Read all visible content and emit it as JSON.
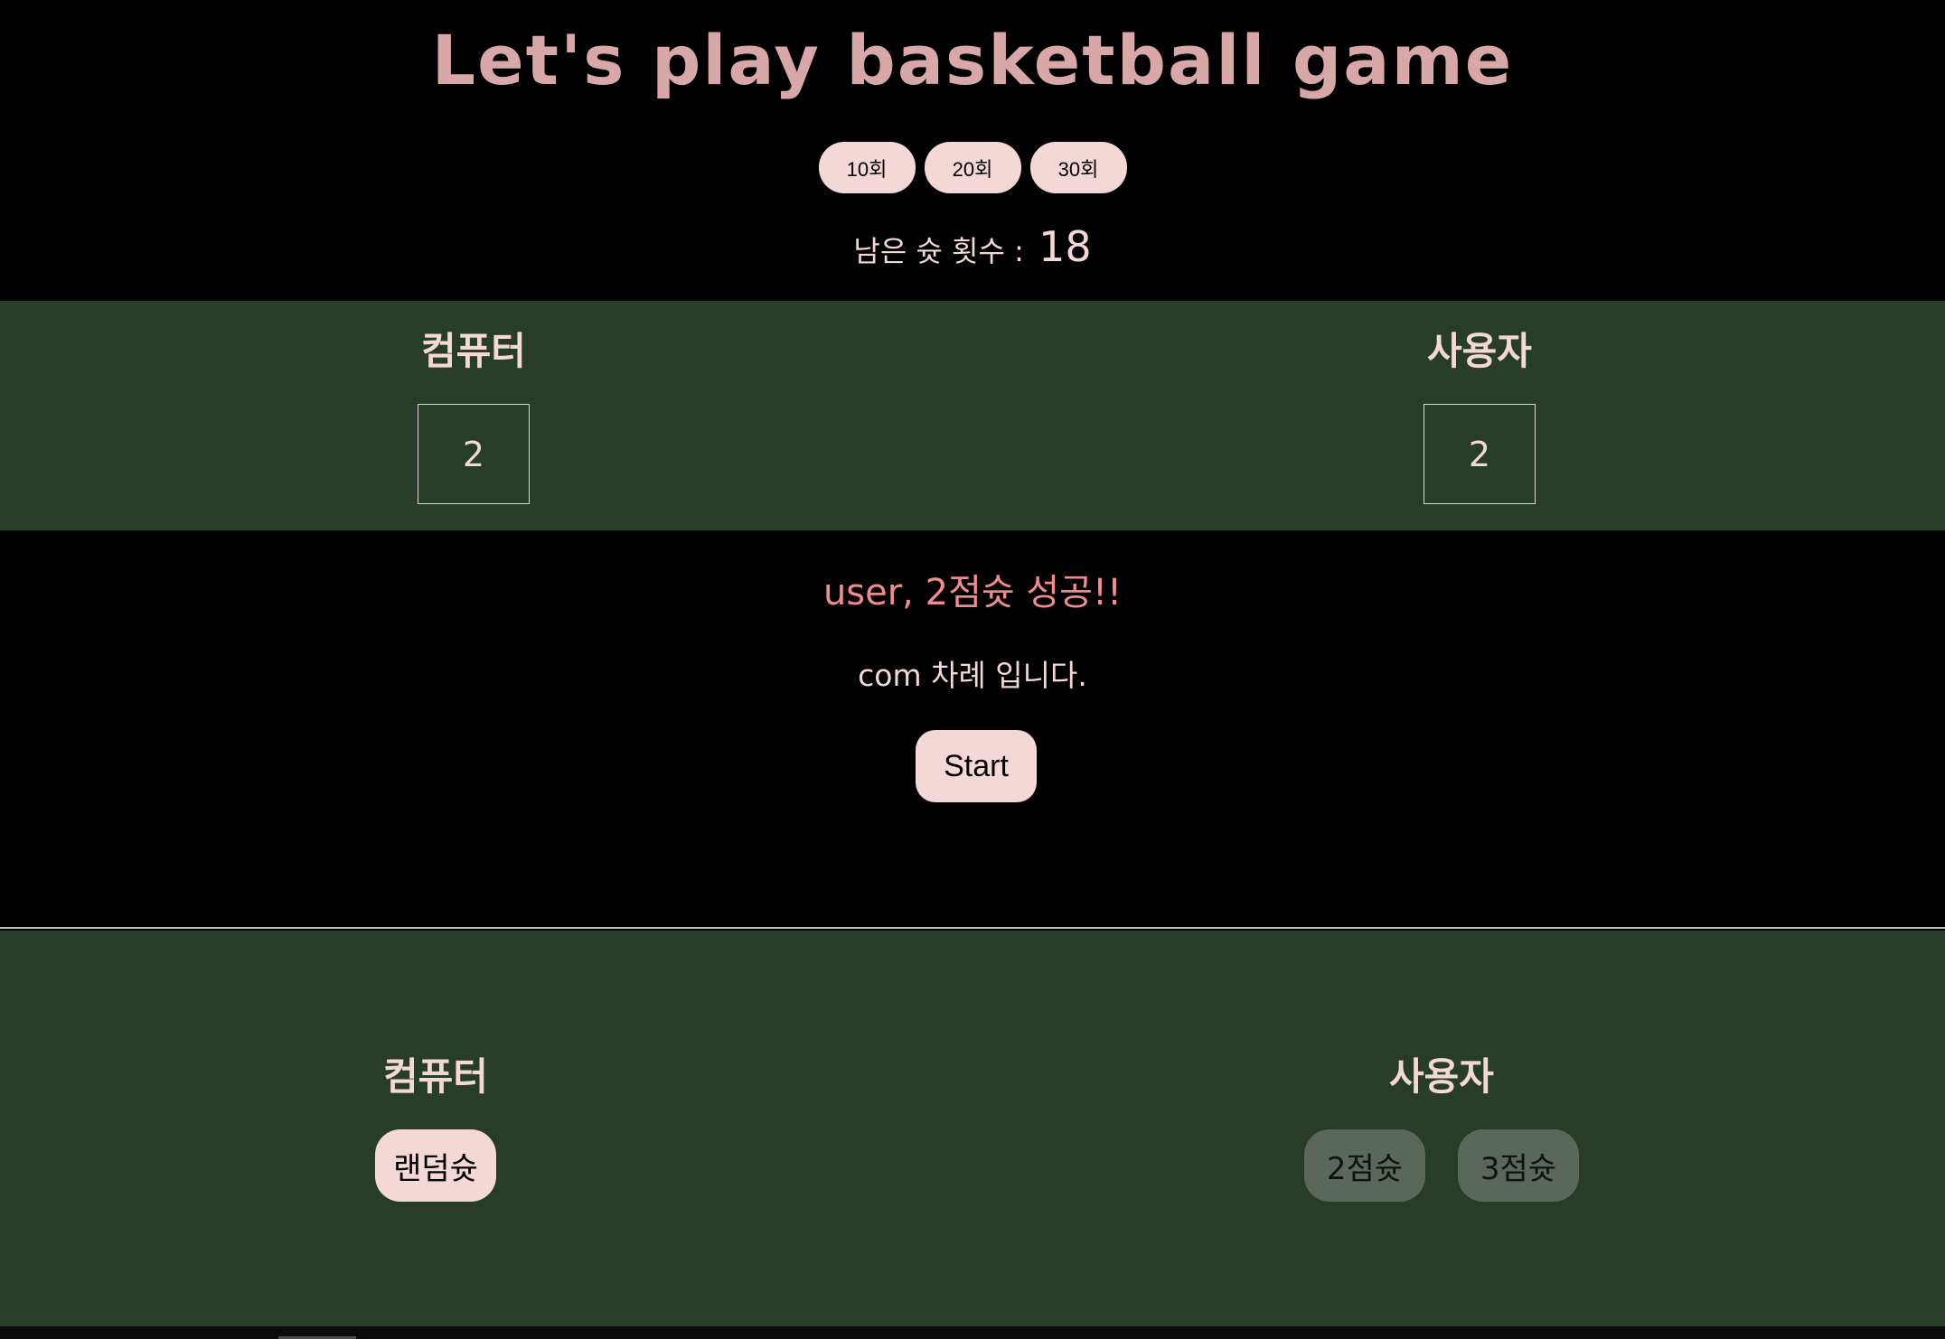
{
  "title": "Let's play basketball game",
  "rounds": [
    {
      "label": "10회"
    },
    {
      "label": "20회"
    },
    {
      "label": "30회"
    }
  ],
  "remaining": {
    "label": "남은 슛 횟수 :",
    "count": "18"
  },
  "scoreboard": {
    "computer": {
      "name": "컴퓨터",
      "score": "2"
    },
    "user": {
      "name": "사용자",
      "score": "2"
    }
  },
  "message": "user, 2점슛 성공!!",
  "turn_text": "com 차례 입니다.",
  "start_label": "Start",
  "controls": {
    "computer": {
      "name": "컴퓨터",
      "random_shot": "랜덤슛"
    },
    "user": {
      "name": "사용자",
      "two_point": "2점슛",
      "three_point": "3점슛"
    }
  },
  "colors": {
    "background": "#000000",
    "band": "#273d2a",
    "accent": "#f4d7d7",
    "title": "#d8a7a7",
    "message": "#f08c8c",
    "disabled_button": "#5c675c"
  }
}
